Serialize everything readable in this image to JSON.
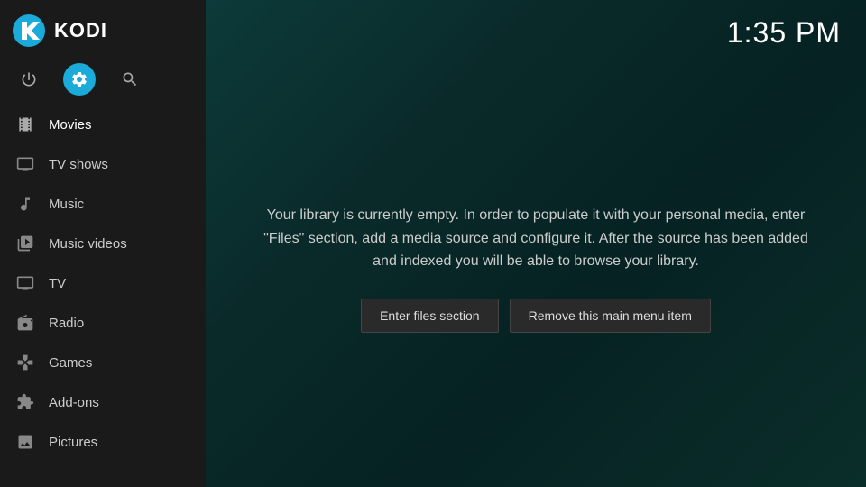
{
  "app": {
    "title": "KODI"
  },
  "clock": {
    "time": "1:35 PM"
  },
  "sidebar": {
    "icon_buttons": [
      {
        "id": "power",
        "label": "Power",
        "active": false
      },
      {
        "id": "settings",
        "label": "Settings",
        "active": true
      },
      {
        "id": "search",
        "label": "Search",
        "active": false
      }
    ],
    "nav_items": [
      {
        "id": "movies",
        "label": "Movies",
        "icon": "movies",
        "active": true
      },
      {
        "id": "tvshows",
        "label": "TV shows",
        "icon": "tv"
      },
      {
        "id": "music",
        "label": "Music",
        "icon": "music"
      },
      {
        "id": "musicvideos",
        "label": "Music videos",
        "icon": "musicvideos"
      },
      {
        "id": "tv",
        "label": "TV",
        "icon": "tv2"
      },
      {
        "id": "radio",
        "label": "Radio",
        "icon": "radio"
      },
      {
        "id": "games",
        "label": "Games",
        "icon": "games"
      },
      {
        "id": "addons",
        "label": "Add-ons",
        "icon": "addons"
      },
      {
        "id": "pictures",
        "label": "Pictures",
        "icon": "pictures"
      }
    ]
  },
  "main": {
    "empty_text": "Your library is currently empty. In order to populate it with your personal media, enter \"Files\" section, add a media source and configure it. After the source has been added and indexed you will be able to browse your library.",
    "buttons": {
      "enter_files": "Enter files section",
      "remove_item": "Remove this main menu item"
    }
  }
}
